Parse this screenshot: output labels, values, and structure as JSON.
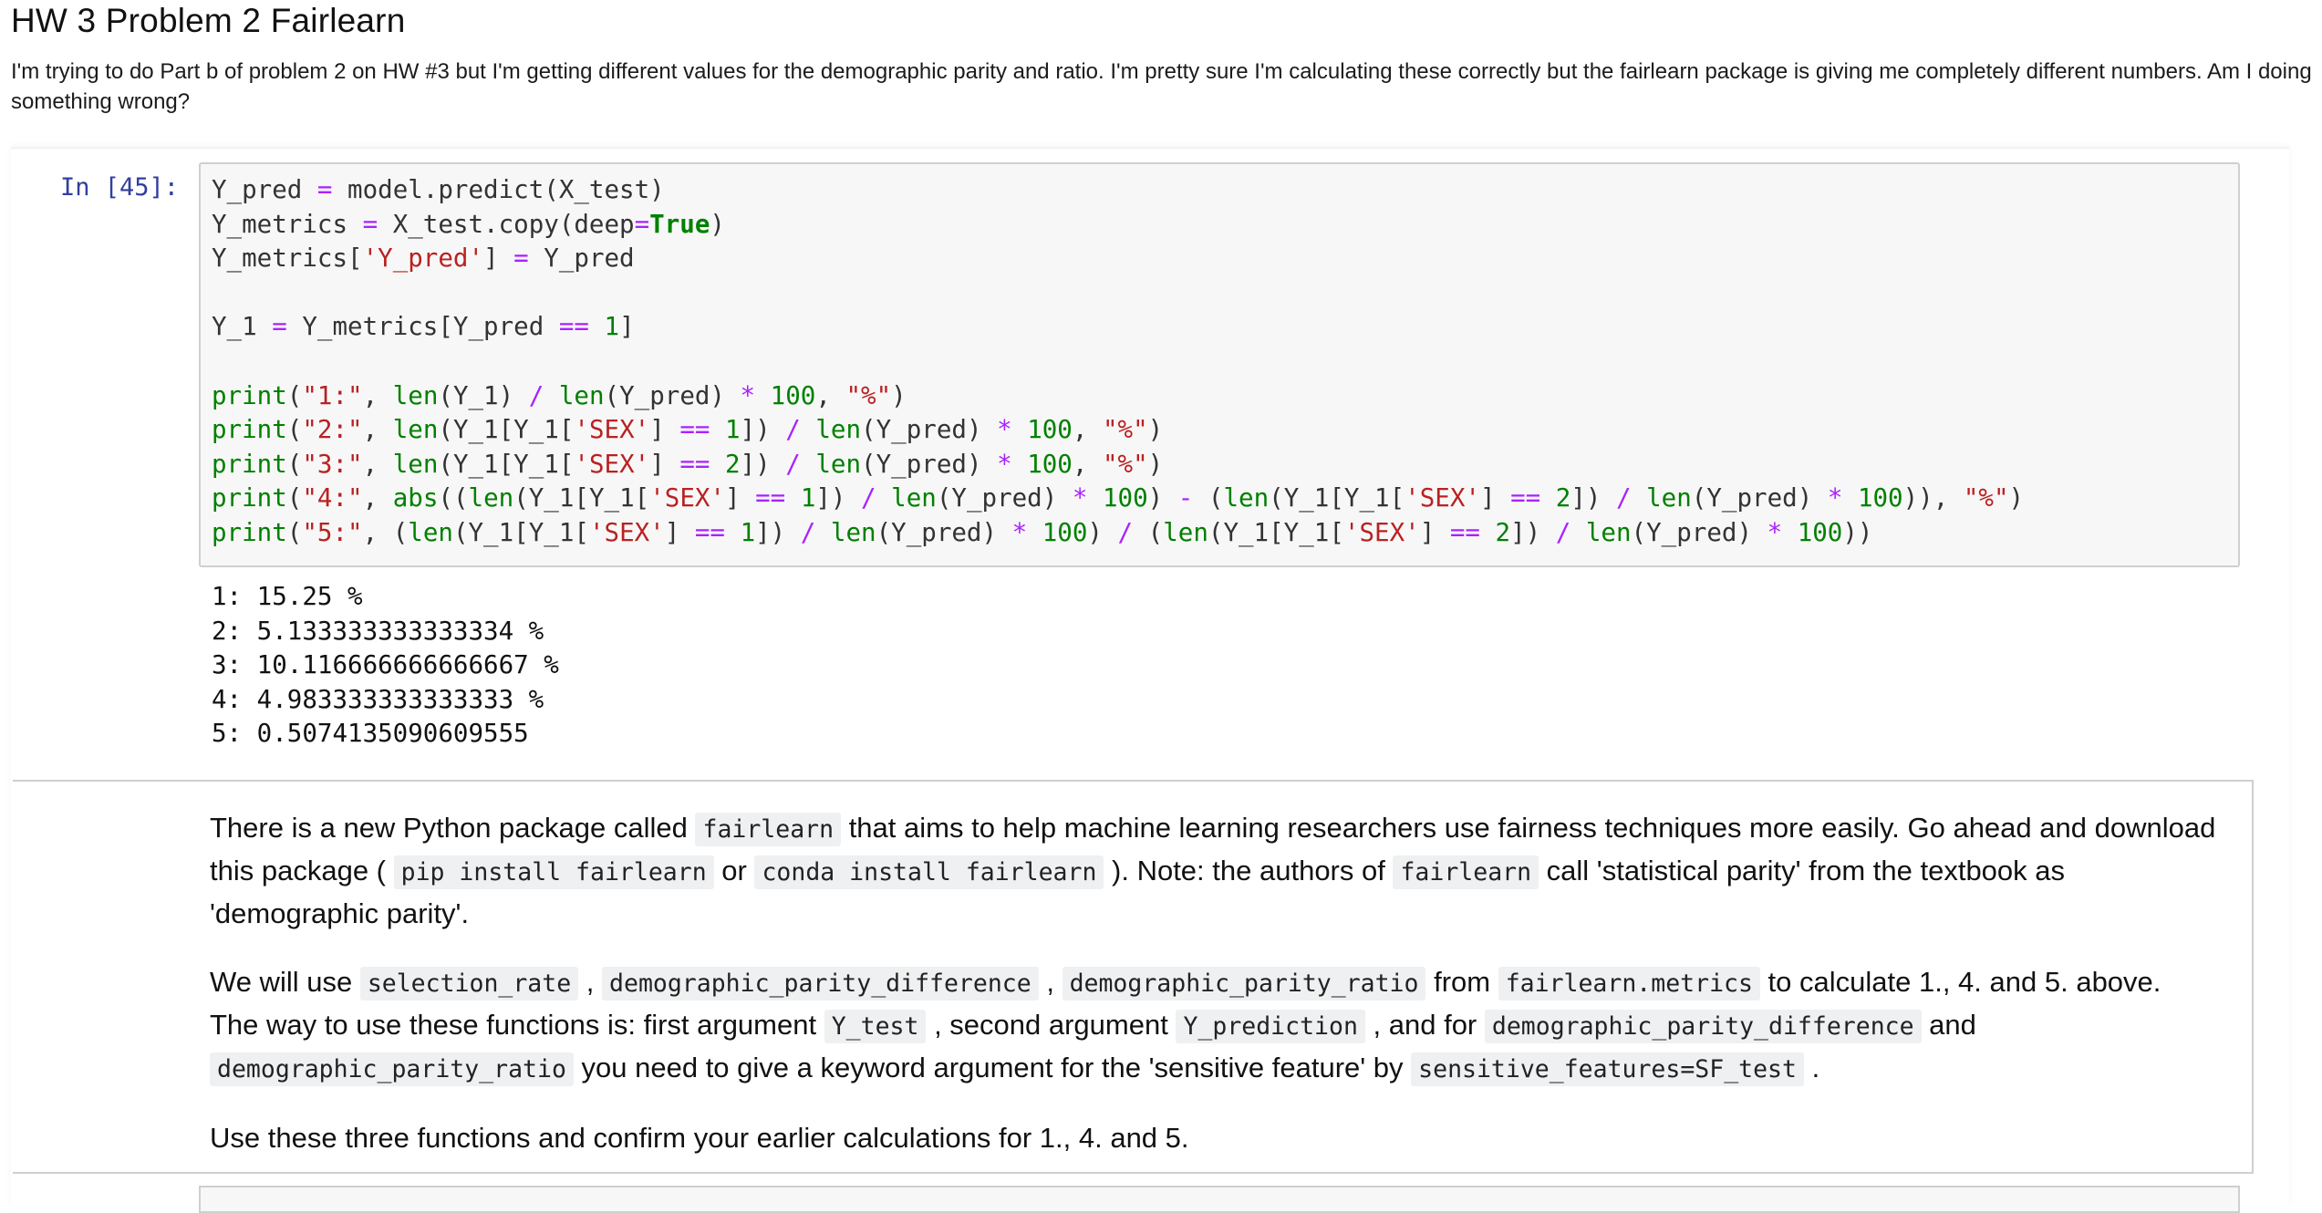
{
  "post": {
    "title": "HW 3 Problem 2 Fairlearn",
    "body": "I'm trying to do Part b of problem 2 on HW #3 but I'm getting different values for the demographic parity and ratio. I'm pretty sure I'm calculating these correctly but the fairlearn package is giving me completely different numbers. Am I doing something wrong?"
  },
  "notebook": {
    "prompt": "In [45]:",
    "output": "1: 15.25 %\n2: 5.133333333333334 %\n3: 10.116666666666667 %\n4: 4.983333333333333 %\n5: 0.5074135090609555"
  },
  "markdown": {
    "p1": {
      "t1": "There is a new Python package called ",
      "c1": "fairlearn",
      "t2": " that aims to help machine learning researchers use fairness techniques more easily. Go ahead and download this package ( ",
      "c2": "pip install fairlearn",
      "t3": " or ",
      "c3": "conda install fairlearn",
      "t4": " ). Note: the authors of ",
      "c4": "fairlearn",
      "t5": " call 'statistical parity' from the textbook as 'demographic parity'."
    },
    "p2": {
      "t1": "We will use ",
      "c1": "selection_rate",
      "t2": " , ",
      "c2": "demographic_parity_difference",
      "t3": " , ",
      "c3": "demographic_parity_ratio",
      "t4": " from ",
      "c4": "fairlearn.metrics",
      "t5": " to calculate 1., 4. and 5. above. The way to use these functions is: first argument ",
      "c5": "Y_test",
      "t6": " , second argument ",
      "c6": "Y_prediction",
      "t7": " , and for ",
      "c7": "demographic_parity_difference",
      "t8": " and ",
      "c8": "demographic_parity_ratio",
      "t9": " you need to give a keyword argument for the 'sensitive feature' by ",
      "c9": "sensitive_features=SF_test",
      "t10": " ."
    },
    "p3": "Use these three functions and confirm your earlier calculations for 1., 4. and 5."
  }
}
